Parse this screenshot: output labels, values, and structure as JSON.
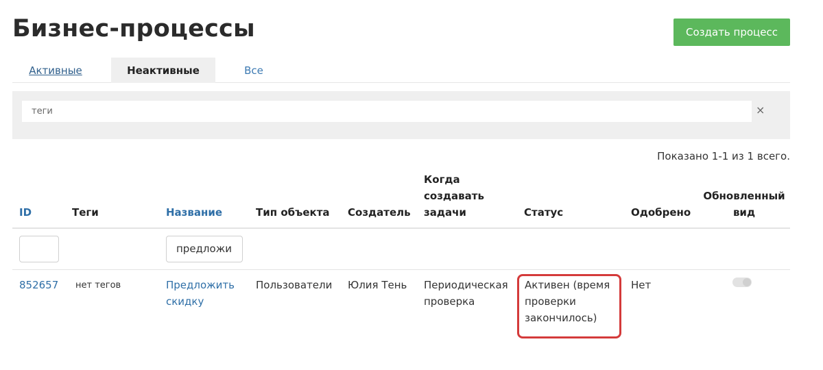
{
  "header": {
    "title": "Бизнес-процессы",
    "create_button": "Создать процесс"
  },
  "tabs": [
    {
      "label": "Активные"
    },
    {
      "label": "Неактивные"
    },
    {
      "label": "Все"
    }
  ],
  "filter": {
    "tags_placeholder": "теги",
    "clear_symbol": "×"
  },
  "summary": {
    "shown_text": "Показано 1-1 из 1 всего."
  },
  "table": {
    "columns": [
      "ID",
      "Теги",
      "Название",
      "Тип объекта",
      "Создатель",
      "Когда создавать задачи",
      "Статус",
      "Одобрено",
      "Обновленный вид"
    ],
    "name_filter_value": "предложи",
    "rows": [
      {
        "id": "852657",
        "tags": "нет тегов",
        "name": "Предложить скидку",
        "object_type": "Пользователи",
        "creator": "Юлия Тень",
        "when": "Периодическая проверка",
        "status": "Активен (время проверки закончилось)",
        "approved": "Нет",
        "updated_view": false
      }
    ]
  },
  "colors": {
    "create_button": "#5cb85c",
    "link": "#2f6fa7",
    "highlight": "#d43a3a"
  }
}
